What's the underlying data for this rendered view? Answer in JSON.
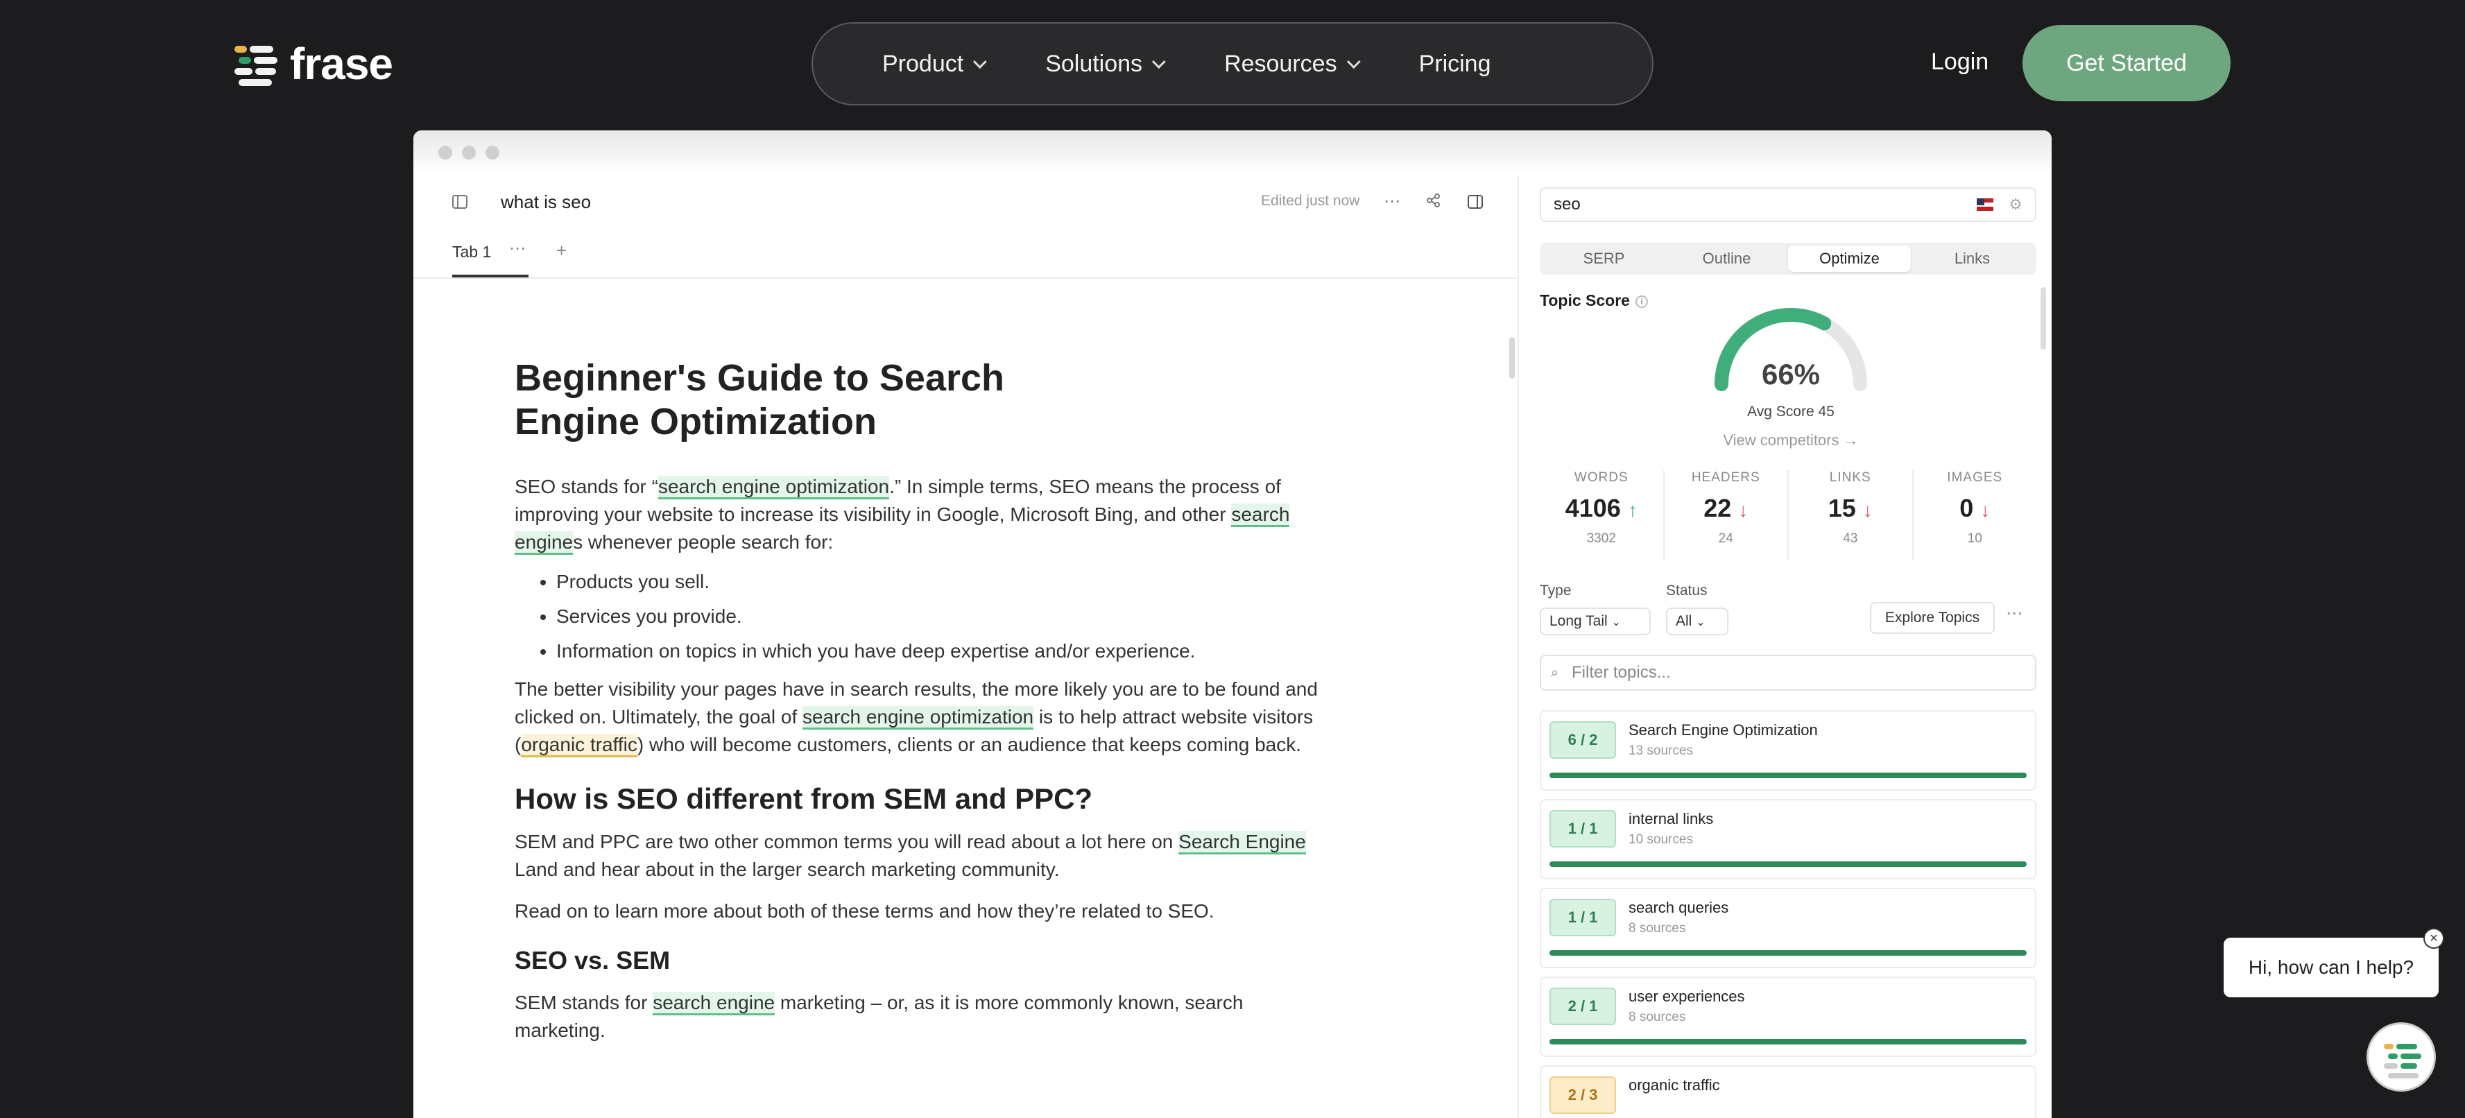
{
  "brand": {
    "name": "frase",
    "accent": "#6ea77f"
  },
  "nav": {
    "items": [
      {
        "label": "Product",
        "has_dropdown": true
      },
      {
        "label": "Solutions",
        "has_dropdown": true
      },
      {
        "label": "Resources",
        "has_dropdown": true
      },
      {
        "label": "Pricing",
        "has_dropdown": false
      }
    ],
    "login": "Login",
    "cta": "Get Started"
  },
  "editor": {
    "doc_name": "what is seo",
    "edited": "Edited just now",
    "tab_label": "Tab 1",
    "title": "Beginner's Guide to Search Engine Optimization",
    "p1": {
      "a": "SEO stands for “",
      "hl1": "search engine optimization",
      "b": ".” In simple terms, SEO means the process of improving your website to increase its visibility in Google, Microsoft Bing, and other ",
      "hl2": "search engine",
      "c": "s whenever people search for:"
    },
    "list": [
      "Products you sell.",
      "Services you provide.",
      "Information on topics in which you have deep expertise and/or experience."
    ],
    "p2": {
      "a": "The better visibility your pages have in search results, the more likely you are to be found and clicked on. Ultimately, the goal of ",
      "hl1": "search engine optimization",
      "b": " is to help attract website visitors (",
      "hl2": "organic traffic",
      "c": ") who will become customers, clients or an audience that keeps coming back."
    },
    "h2": "How is SEO different from SEM and PPC?",
    "p3": {
      "a": "SEM and PPC are two other common terms you will read about a lot here on ",
      "hl1": "Search Engine",
      "b": " Land and hear about in the larger search marketing community."
    },
    "p4": "Read on to learn more about both of these terms and how they’re related to SEO.",
    "h3": "SEO vs. SEM",
    "p5": {
      "a": "SEM stands for ",
      "hl1": "search engine",
      "b": " marketing – or, as it is more commonly known, search marketing."
    }
  },
  "panel": {
    "query": "seo",
    "tabs": [
      "SERP",
      "Outline",
      "Optimize",
      "Links"
    ],
    "active_tab": "Optimize",
    "topic_score_label": "Topic Score",
    "score": "66%",
    "score_fraction": 0.66,
    "avg_score": "Avg Score 45",
    "view_competitors": "View competitors →",
    "stats": [
      {
        "label": "WORDS",
        "value": "4106",
        "trend": "up",
        "sub": "3302"
      },
      {
        "label": "HEADERS",
        "value": "22",
        "trend": "down",
        "sub": "24"
      },
      {
        "label": "LINKS",
        "value": "15",
        "trend": "down",
        "sub": "43"
      },
      {
        "label": "IMAGES",
        "value": "0",
        "trend": "down",
        "sub": "10"
      }
    ],
    "type_label": "Type",
    "type_value": "Long Tail",
    "status_label": "Status",
    "status_value": "All",
    "explore": "Explore Topics",
    "filter_placeholder": "Filter topics...",
    "topics": [
      {
        "count": "6 / 2",
        "name": "Search Engine Optimization",
        "sources": "13 sources",
        "fill": 1.0,
        "warn": false
      },
      {
        "count": "1 / 1",
        "name": "internal links",
        "sources": "10 sources",
        "fill": 1.0,
        "warn": false
      },
      {
        "count": "1 / 1",
        "name": "search queries",
        "sources": "8 sources",
        "fill": 1.0,
        "warn": false
      },
      {
        "count": "2 / 1",
        "name": "user experiences",
        "sources": "8 sources",
        "fill": 1.0,
        "warn": false
      },
      {
        "count": "2 / 3",
        "name": "organic traffic",
        "sources": "",
        "fill": 0.66,
        "warn": true
      }
    ]
  },
  "chat": {
    "message": "Hi, how can I help?"
  }
}
